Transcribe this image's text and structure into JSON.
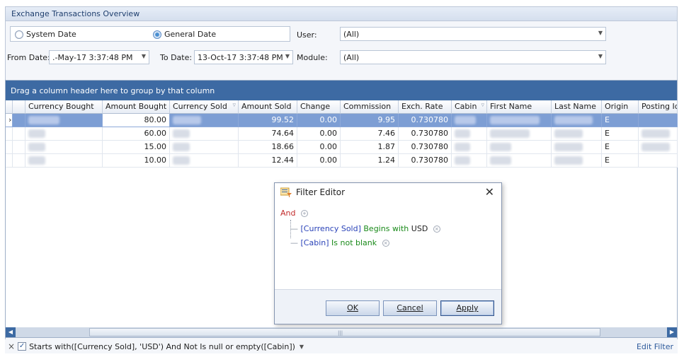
{
  "panel": {
    "title": "Exchange Transactions Overview"
  },
  "date_mode": {
    "system_label": "System Date",
    "general_label": "General Date",
    "selected": "General Date"
  },
  "from_date": {
    "label": "From Date:",
    "value": ".-May-17 3:37:48 PM"
  },
  "to_date": {
    "label": "To Date:",
    "value": "13-Oct-17 3:37:48 PM"
  },
  "user": {
    "label": "User:",
    "value": "(All)"
  },
  "module": {
    "label": "Module:",
    "value": "(All)"
  },
  "grid": {
    "group_hint": "Drag a column header here to group by that column",
    "columns": [
      "Currency Bought",
      "Amount Bought",
      "Currency Sold",
      "Amount Sold",
      "Change",
      "Commission",
      "Exch. Rate",
      "Cabin",
      "First Name",
      "Last Name",
      "Origin",
      "Posting Id"
    ],
    "rows": [
      {
        "amount_bought": "80.00",
        "amount_sold": "99.52",
        "change": "0.00",
        "commission": "9.95",
        "exch_rate": "0.730780",
        "origin": "E"
      },
      {
        "amount_bought": "60.00",
        "amount_sold": "74.64",
        "change": "0.00",
        "commission": "7.46",
        "exch_rate": "0.730780",
        "origin": "E"
      },
      {
        "amount_bought": "15.00",
        "amount_sold": "18.66",
        "change": "0.00",
        "commission": "1.87",
        "exch_rate": "0.730780",
        "origin": "E"
      },
      {
        "amount_bought": "10.00",
        "amount_sold": "12.44",
        "change": "0.00",
        "commission": "1.24",
        "exch_rate": "0.730780",
        "origin": "E"
      }
    ],
    "selected_row": 0
  },
  "filter_bar": {
    "expression": "Starts with([Currency Sold], 'USD') And Not Is null or empty([Cabin])",
    "edit_label": "Edit Filter"
  },
  "filter_editor": {
    "title": "Filter Editor",
    "group_op": "And",
    "conditions": [
      {
        "field": "[Currency Sold]",
        "operator": "Begins with",
        "value": "USD"
      },
      {
        "field": "[Cabin]",
        "operator": "Is not blank",
        "value": ""
      }
    ],
    "ok_label": "OK",
    "cancel_label": "Cancel",
    "apply_label": "Apply"
  },
  "colors": {
    "accent": "#3d6aa3",
    "selection": "#7d9ed4",
    "operator": "#c22a2a",
    "field": "#2a43b8",
    "condition": "#1a8a1a"
  }
}
